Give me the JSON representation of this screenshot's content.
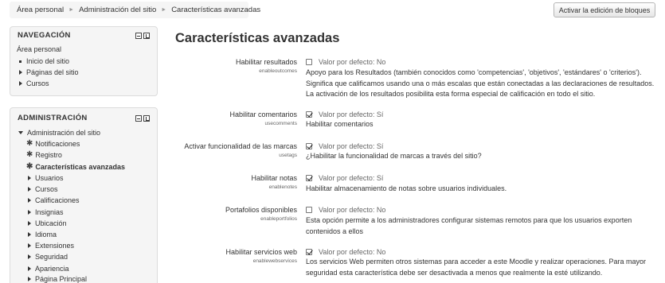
{
  "breadcrumb": [
    "Área personal",
    "Administración del sitio",
    "Características avanzadas"
  ],
  "edit_blocks_label": "Activar la edición de bloques",
  "nav_block": {
    "title": "NAVEGACIÓN",
    "items": [
      "Área personal",
      "Inicio del sitio",
      "Páginas del sitio",
      "Cursos"
    ]
  },
  "admin_block": {
    "title": "ADMINISTRACIÓN",
    "items": [
      "Administración del sitio",
      "Notificaciones",
      "Registro",
      "Características avanzadas",
      "Usuarios",
      "Cursos",
      "Calificaciones",
      "Insignias",
      "Ubicación",
      "Idioma",
      "Extensiones",
      "Seguridad",
      "Apariencia",
      "Página Principal"
    ]
  },
  "page_title": "Características avanzadas",
  "settings": [
    {
      "label": "Habilitar resultados",
      "key": "enableoutcomes",
      "checked": false,
      "default": "Valor por defecto: No",
      "description": "Apoyo para los Resultados (también conocidos como 'competencias', 'objetivos', 'estándares' o 'criterios'). Significa que calificamos usando una o más escalas que están conectadas a las declaraciones de resultados. La activación de los resultados posibilita esta forma especial de calificación en todo el sitio."
    },
    {
      "label": "Habilitar comentarios",
      "key": "usecomments",
      "checked": true,
      "default": "Valor por defecto: Sí",
      "description": "Habilitar comentarios"
    },
    {
      "label": "Activar funcionalidad de las marcas",
      "key": "usetags",
      "checked": true,
      "default": "Valor por defecto: Sí",
      "description": "¿Habilitar la funcionalidad de marcas a través del sitio?"
    },
    {
      "label": "Habilitar notas",
      "key": "enablenotes",
      "checked": true,
      "default": "Valor por defecto: Sí",
      "description": "Habilitar almacenamiento de notas sobre usuarios individuales."
    },
    {
      "label": "Portafolios disponibles",
      "key": "enableportfolios",
      "checked": false,
      "default": "Valor por defecto: No",
      "description": "Esta opción permite a los administradores configurar sistemas remotos para que los usuarios exporten contenidos a ellos"
    },
    {
      "label": "Habilitar servicios web",
      "key": "enablewebservices",
      "checked": true,
      "default": "Valor por defecto: No",
      "description": "Los servicios Web permiten otros sistemas para acceder a este Moodle y realizar operaciones. Para mayor seguridad esta característica debe ser desactivada a menos que realmente la esté utilizando."
    }
  ]
}
